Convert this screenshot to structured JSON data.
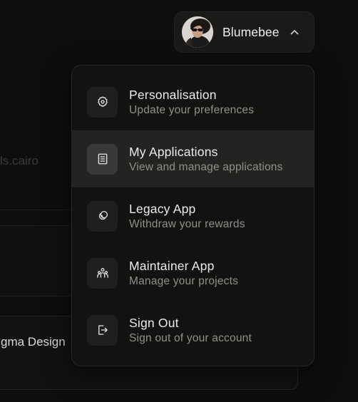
{
  "background": {
    "partial_text": "ls.cairo",
    "card_text": "gma Design"
  },
  "user": {
    "name": "Blumebee",
    "avatar_icon": "user-avatar-photo",
    "chevron_icon": "chevron-up-icon"
  },
  "menu": {
    "items": [
      {
        "title": "Personalisation",
        "subtitle": "Update your preferences",
        "icon": "gear-icon",
        "active": false
      },
      {
        "title": "My Applications",
        "subtitle": "View and manage applications",
        "icon": "document-icon",
        "active": true
      },
      {
        "title": "Legacy App",
        "subtitle": "Withdraw your rewards",
        "icon": "coins-icon",
        "active": false
      },
      {
        "title": "Maintainer App",
        "subtitle": "Manage your projects",
        "icon": "users-icon",
        "active": false
      },
      {
        "title": "Sign Out",
        "subtitle": "Sign out of your account",
        "icon": "logout-icon",
        "active": false
      }
    ]
  },
  "colors": {
    "background": "#0e0e0d",
    "menu_bg": "#121211",
    "active_item": "#232321",
    "text_primary": "#ececec",
    "text_secondary": "#8f8f8c"
  }
}
